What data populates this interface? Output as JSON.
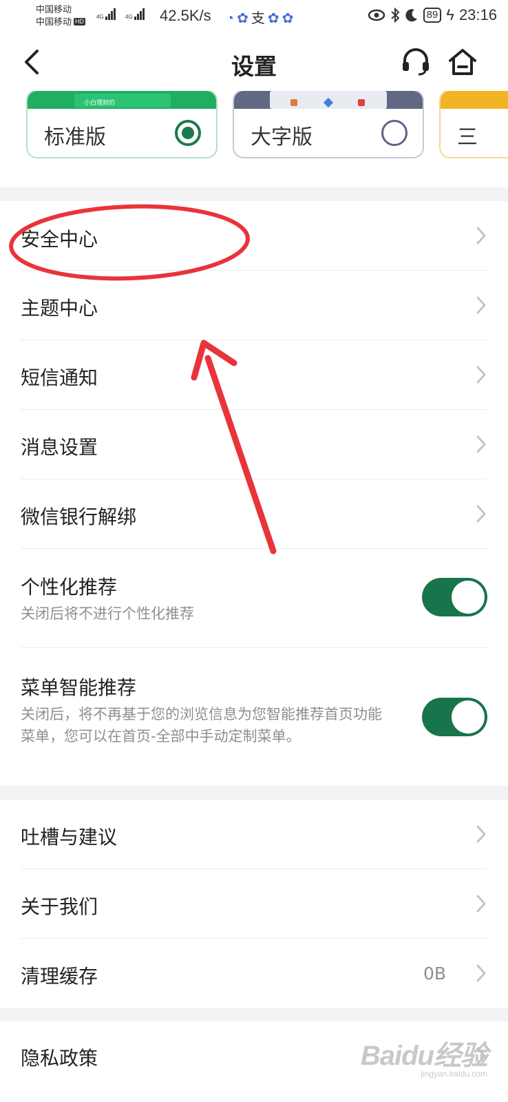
{
  "status_bar": {
    "carrier_1": "中国移动",
    "carrier_2": "中国移动",
    "hd_badge": "HD",
    "network_1": "4G",
    "network_2": "4G",
    "speed": "42.5K/s",
    "battery": "89",
    "time": "23:16"
  },
  "header": {
    "title": "设置",
    "back_icon": "chevron-left-icon",
    "service_icon": "headset-icon",
    "home_icon": "home-icon"
  },
  "versions": [
    {
      "label": "标准版",
      "selected": true,
      "thumb_text": "小白理财的"
    },
    {
      "label": "大字版",
      "selected": false
    },
    {
      "label": "三",
      "selected": false
    }
  ],
  "group1": [
    {
      "label": "安全中心"
    },
    {
      "label": "主题中心"
    },
    {
      "label": "短信通知"
    },
    {
      "label": "消息设置"
    },
    {
      "label": "微信银行解绑"
    }
  ],
  "toggles": [
    {
      "label": "个性化推荐",
      "desc": "关闭后将不进行个性化推荐",
      "on": true
    },
    {
      "label": "菜单智能推荐",
      "desc": "关闭后，将不再基于您的浏览信息为您智能推荐首页功能菜单，您可以在首页-全部中手动定制菜单。",
      "on": true
    }
  ],
  "group2": [
    {
      "label": "吐槽与建议"
    },
    {
      "label": "关于我们"
    },
    {
      "label": "清理缓存",
      "value": "0B"
    }
  ],
  "group3": [
    {
      "label": "隐私政策"
    }
  ],
  "colors": {
    "accent": "#18744a",
    "annotation": "#e8343a",
    "gap": "#f3f3f5"
  },
  "watermark": {
    "brand": "Baidu经验",
    "url": "jingyan.baidu.com"
  }
}
